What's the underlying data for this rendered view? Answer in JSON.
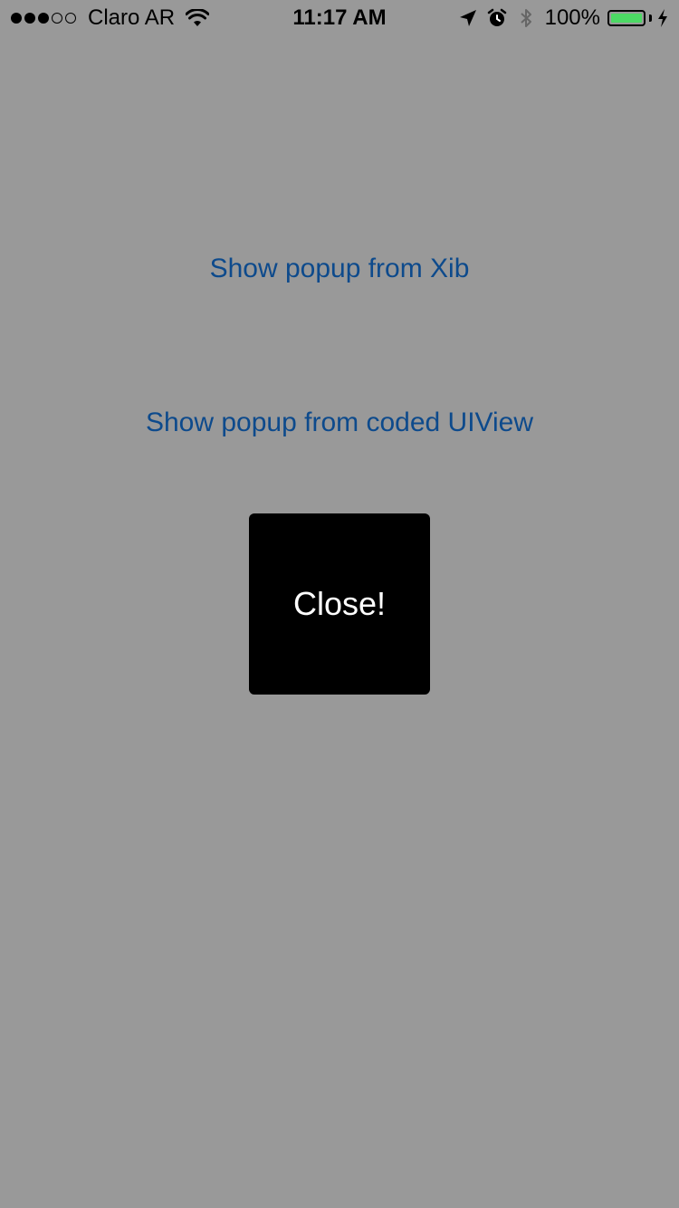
{
  "status_bar": {
    "carrier": "Claro AR",
    "time": "11:17 AM",
    "battery_percent": "100%",
    "signal_filled": 3,
    "signal_total": 5,
    "battery_color": "#4cd964"
  },
  "main": {
    "background_color": "#999999",
    "link_color": "#0d4a8c",
    "xib_button_label": "Show popup from Xib",
    "coded_button_label": "Show popup from coded UIView"
  },
  "popup": {
    "close_label": "Close!",
    "background_color": "#000000"
  }
}
